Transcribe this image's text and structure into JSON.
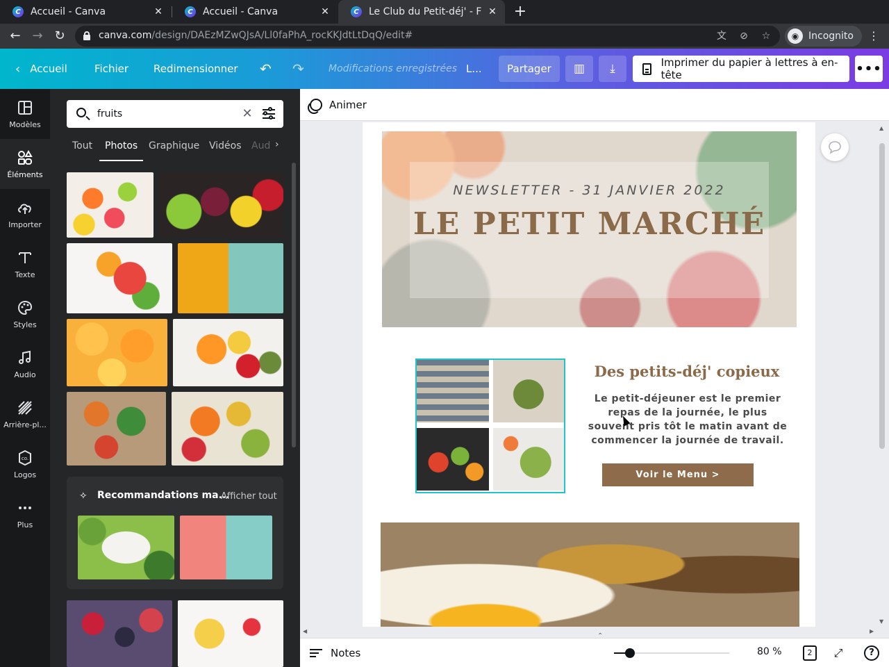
{
  "browser": {
    "tabs": [
      {
        "title": "Accueil - Canva",
        "active": false
      },
      {
        "title": "Accueil - Canva",
        "active": false
      },
      {
        "title": "Le Club du Petit-déj' - Form",
        "active": true
      }
    ],
    "url_host": "canva.com",
    "url_path": "/design/DAEzMZwQJsA/Ll0faPhA_rocKKJdtLtDqQ/edit#",
    "incognito_label": "Incognito"
  },
  "topbar": {
    "home": "Accueil",
    "file": "Fichier",
    "resize": "Redimensionner",
    "saved": "Modifications enregistrées",
    "title_short": "L...",
    "share": "Partager",
    "print": "Imprimer du papier à lettres à en-tête",
    "more": "•••"
  },
  "rail": [
    {
      "label": "Modèles",
      "icon": "templates-icon"
    },
    {
      "label": "Éléments",
      "icon": "elements-icon"
    },
    {
      "label": "Importer",
      "icon": "upload-cloud-icon"
    },
    {
      "label": "Texte",
      "icon": "text-icon"
    },
    {
      "label": "Styles",
      "icon": "palette-icon"
    },
    {
      "label": "Audio",
      "icon": "music-note-icon"
    },
    {
      "label": "Arrière-pl...",
      "icon": "background-pattern-icon"
    },
    {
      "label": "Logos",
      "icon": "logo-icon"
    },
    {
      "label": "Plus",
      "icon": "more-dots-icon"
    }
  ],
  "panel": {
    "search_value": "fruits",
    "tabs": [
      "Tout",
      "Photos",
      "Graphique",
      "Vidéos",
      "Aud"
    ],
    "reco_title": "Recommandations ma...",
    "reco_all": "Afficher tout"
  },
  "editor": {
    "animate": "Animer",
    "newsletter_date": "NEWSLETTER - 31 JANVIER 2022",
    "main_title": "LE PETIT MARCHÉ",
    "section_title": "Des petits-déj' copieux",
    "section_body": "Le petit-déjeuner est le premier repas de la journée, le plus souvent pris tôt le matin avant de commencer la journée de travail.",
    "menu_button": "Voir le Menu >",
    "notes": "Notes",
    "zoom": "80 %",
    "zoom_level": 0.8,
    "page_count": "2"
  },
  "colors": {
    "brand_start": "#00b6cd",
    "brand_end": "#7b3be3",
    "accent_brown": "#8a6a48",
    "selection": "#20c4cb"
  }
}
